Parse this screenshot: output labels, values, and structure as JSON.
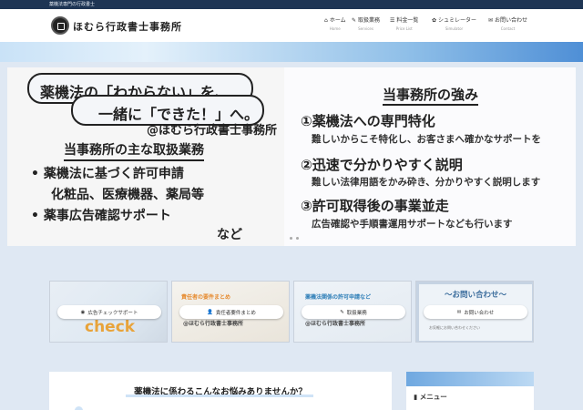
{
  "top_strip": {
    "text": "薬機法専門の行政書士"
  },
  "header": {
    "logo_text": "ほむら行政書士事務所",
    "nav": [
      {
        "icon": "home-icon",
        "glyph": "⌂",
        "label": "ホーム",
        "sub": "Home"
      },
      {
        "icon": "pen-icon",
        "glyph": "✎",
        "label": "取扱業務",
        "sub": "Services"
      },
      {
        "icon": "list-icon",
        "glyph": "☰",
        "label": "料金一覧",
        "sub": "Price List"
      },
      {
        "icon": "gear-icon",
        "glyph": "✿",
        "label": "シュミレーター",
        "sub": "Simulator"
      },
      {
        "icon": "mail-icon",
        "glyph": "✉",
        "label": "お問い合わせ",
        "sub": "Contact"
      }
    ]
  },
  "hero": {
    "bubble1": "薬機法の「わからない」を、",
    "bubble2": "一緒に「できた！」へ。",
    "firm": "@ほむら行政書士事務所",
    "left_heading": "当事務所の主な取扱業務",
    "left_items": [
      "• 薬機法に基づく許可申請",
      "化粧品、医療機器、薬局等",
      "• 薬事広告確認サポート",
      "など"
    ],
    "right_title": "当事務所の強み",
    "strengths": [
      {
        "head": "①薬機法への専門特化",
        "sub": "難しいからこそ特化し、お客さまへ確かなサポートを"
      },
      {
        "head": "②迅速で分かりやすく説明",
        "sub": "難しい法律用語をかみ砕き、分かりやすく説明します"
      },
      {
        "head": "③許可取得後の事業並走",
        "sub": "広告確認や手順書運用サポートなども行います"
      }
    ]
  },
  "cards": [
    {
      "button": "広告チェックサポート",
      "icon": "cursor-icon",
      "glyph": "◉",
      "image_text": "check"
    },
    {
      "button": "責任者要件まとめ",
      "icon": "user-icon",
      "glyph": "👤",
      "image_title": "責任者の要件まとめ",
      "image_caption": "@ほむら行政書士事務所"
    },
    {
      "button": "取扱業務",
      "icon": "pen-icon",
      "glyph": "✎",
      "image_title": "薬機法関係の許可申請など",
      "image_caption": "@ほむら行政書士事務所"
    },
    {
      "button": "お問い合わせ",
      "icon": "mail-icon",
      "glyph": "✉",
      "image_title": "～お問い合わせ～",
      "image_caption": "お気軽にお問い合わせください"
    }
  ],
  "main": {
    "heading": "薬機法に係わるこんなお悩みありませんか？"
  },
  "sidebar": {
    "menu_label": "メニュー",
    "menu_icon": "book-icon",
    "menu_glyph": "▮"
  },
  "colors": {
    "top_strip": "#1e3554",
    "accent_card_title": "#3e6f9e",
    "background": "#dfe8f3"
  }
}
